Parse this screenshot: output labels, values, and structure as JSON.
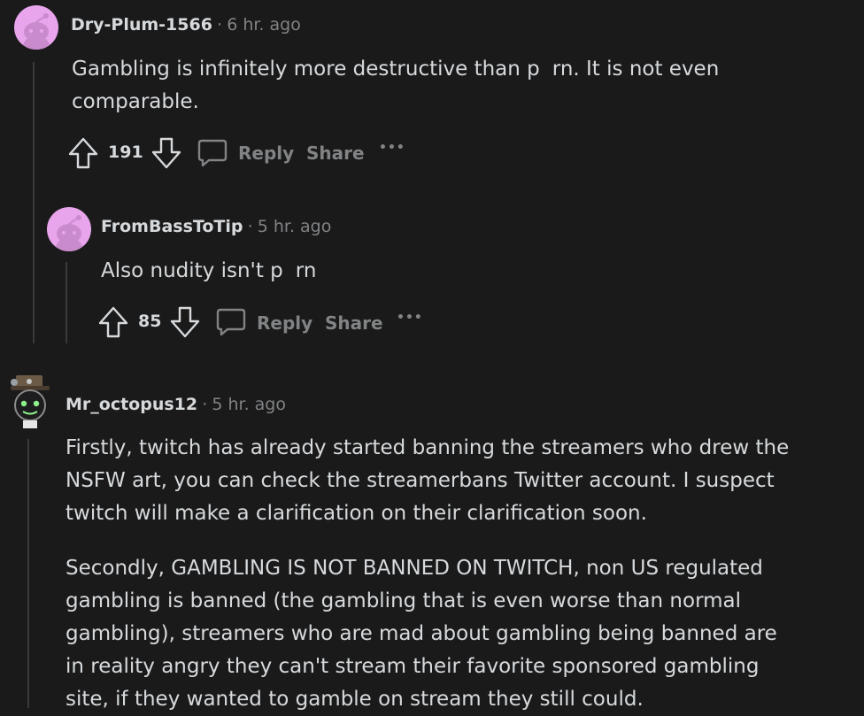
{
  "comments": [
    {
      "username": "Dry-Plum-1566",
      "separator": "·",
      "time": "6 hr. ago",
      "lines": [
        "Gambling is infinitely more destructive than p",
        "rn. It is not even",
        "comparable."
      ],
      "votes": "191",
      "reply_label": "Reply",
      "share_label": "Share",
      "more_label": "•••"
    },
    {
      "username": "FromBassToTip",
      "separator": "·",
      "time": "5 hr. ago",
      "lines": [
        "Also nudity isn't p",
        "rn"
      ],
      "votes": "85",
      "reply_label": "Reply",
      "share_label": "Share",
      "more_label": "•••"
    },
    {
      "username": "Mr_octopus12",
      "separator": "·",
      "time": "5 hr. ago",
      "paragraphs": [
        [
          "Firstly, twitch has already started banning the streamers who drew the",
          "NSFW art, you can check the streamerbans Twitter account. I suspect",
          "twitch will make a clarification on their clarification soon."
        ],
        [
          "Secondly, GAMBLING IS NOT BANNED ON TWITCH, non US regulated",
          "gambling is banned (the gambling that is even worse than normal",
          "gambling), streamers who are mad about gambling being banned are",
          "in reality angry they can't stream their favorite sponsored gambling",
          "site, if they wanted to gamble on stream they still could."
        ]
      ]
    }
  ],
  "colors": {
    "background": "#1a1a1b",
    "text": "#d7dadc",
    "muted": "#818384",
    "thread_line": "#3a3a3c",
    "avatar_pink": "#e9a5ec"
  }
}
